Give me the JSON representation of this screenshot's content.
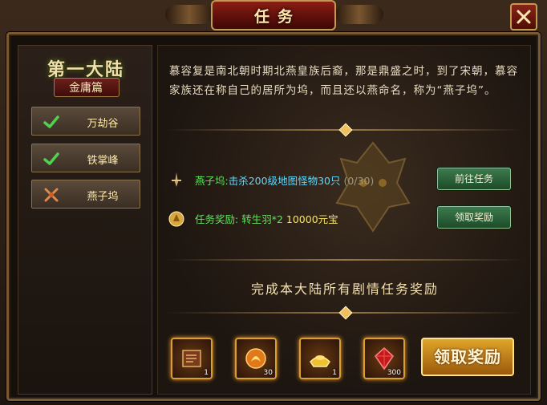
{
  "window": {
    "title": "任务"
  },
  "left_panel": {
    "continent_title": "第一大陆",
    "continent_subtitle": "金庸篇",
    "chapters": [
      {
        "label": "万劫谷",
        "status": "completed"
      },
      {
        "label": "铁掌峰",
        "status": "completed"
      },
      {
        "label": "燕子坞",
        "status": "current"
      }
    ]
  },
  "story": {
    "text": "慕容复是南北朝时期北燕皇族后裔，那是鼎盛之时，到了宋朝，慕容家族还在称自己的居所为坞，而且还以燕命名，称为“燕子坞”。"
  },
  "task": {
    "location": "燕子坞:",
    "objective": "击杀200级地图怪物30只",
    "progress": "(0/30)",
    "goto_button": "前往任务"
  },
  "reward": {
    "label": "任务奖励:",
    "item1": "转生羽*2",
    "item2": "10000元宝",
    "claim_button": "领取奖励"
  },
  "continent_reward": {
    "heading": "完成本大陆所有剧情任务奖励",
    "items": [
      {
        "icon": "book-icon",
        "count": "1"
      },
      {
        "icon": "fire-orb-icon",
        "count": "30"
      },
      {
        "icon": "gold-ingot-icon",
        "count": "1"
      },
      {
        "icon": "red-gem-icon",
        "count": "300"
      }
    ],
    "claim_button": "领取奖励"
  },
  "colors": {
    "accent_gold": "#d9a030",
    "completed_green": "#5ee45e",
    "task_cyan": "#5fd8ff"
  }
}
